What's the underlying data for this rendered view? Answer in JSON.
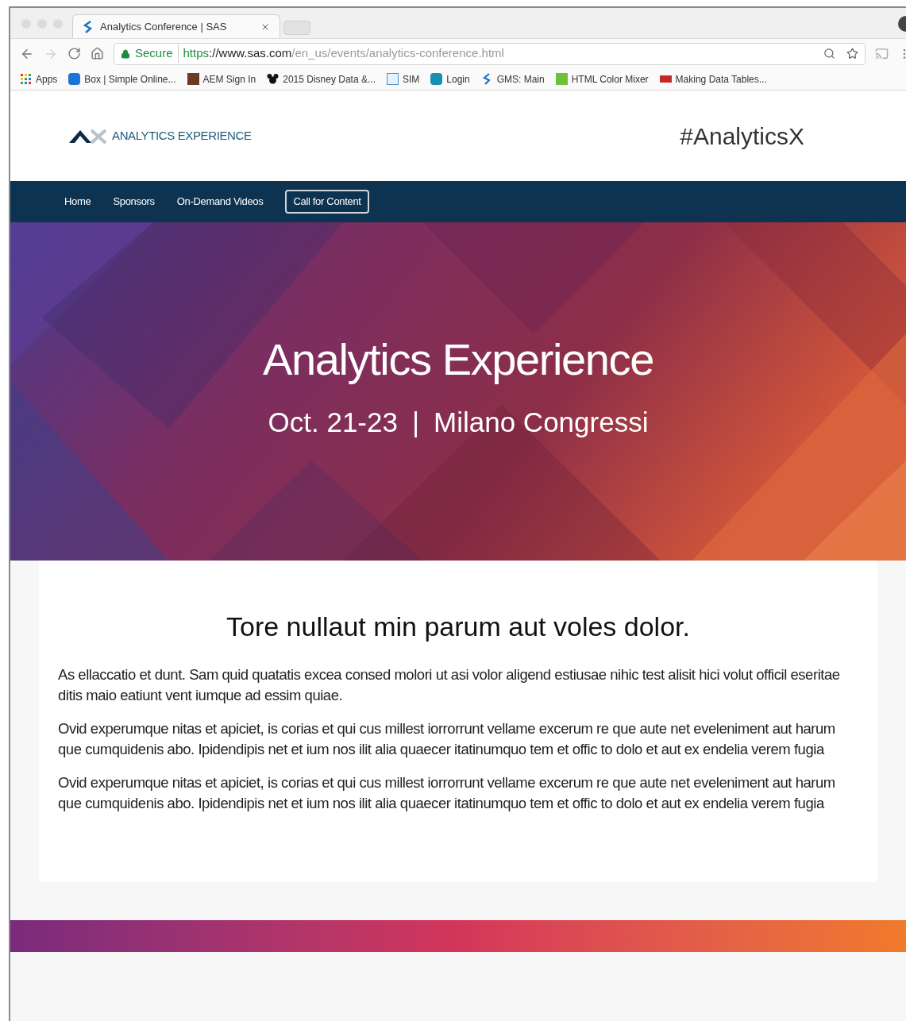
{
  "browser": {
    "tab": {
      "title": "Analytics Conference | SAS"
    },
    "address": {
      "secure_label": "Secure",
      "scheme": "https",
      "host": "://www.sas.com",
      "path": "/en_us/events/analytics-conference.html"
    },
    "bookmarks": [
      {
        "label": "Apps"
      },
      {
        "label": "Box | Simple Online..."
      },
      {
        "label": "AEM Sign In"
      },
      {
        "label": "2015 Disney Data &..."
      },
      {
        "label": "SIM"
      },
      {
        "label": "Login"
      },
      {
        "label": "GMS: Main"
      },
      {
        "label": "HTML Color Mixer"
      },
      {
        "label": "Making Data Tables..."
      }
    ]
  },
  "site_header": {
    "logo_text": "ANALYTICS EXPERIENCE",
    "hashtag": "#AnalyticsX"
  },
  "nav": [
    {
      "label": "Home",
      "kind": "link"
    },
    {
      "label": "Sponsors",
      "kind": "link"
    },
    {
      "label": "On-Demand Videos",
      "kind": "link"
    },
    {
      "label": "Call for Content",
      "kind": "outlined"
    }
  ],
  "hero": {
    "title": "Analytics Experience",
    "date": "Oct. 21-23",
    "separator": "|",
    "venue": "Milano Congressi"
  },
  "content": {
    "heading": "Tore nullaut min parum aut voles dolor.",
    "paragraphs": [
      "As ellaccatio et dunt. Sam quid quatatis excea consed molori ut asi volor aligend estiusae nihic test alisit hici volut officil eseritae ditis maio eatiunt vent iumque ad essim quiae.",
      "Ovid experumque nitas et apiciet, is corias et qui cus millest iorrorrunt vellame excerum re que aute net eveleniment aut harum que cumquidenis abo. Ipidendipis net et ium nos ilit alia quaecer itatinumquo tem et offic to dolo et aut ex endelia verem fugia",
      "Ovid experumque nitas et apiciet, is corias et qui cus millest iorrorrunt vellame excerum re que aute net eveleniment aut harum que cumquidenis abo. Ipidendipis net et ium nos ilit alia quaecer itatinumquo tem et offic to dolo et aut ex endelia verem fugia"
    ]
  }
}
